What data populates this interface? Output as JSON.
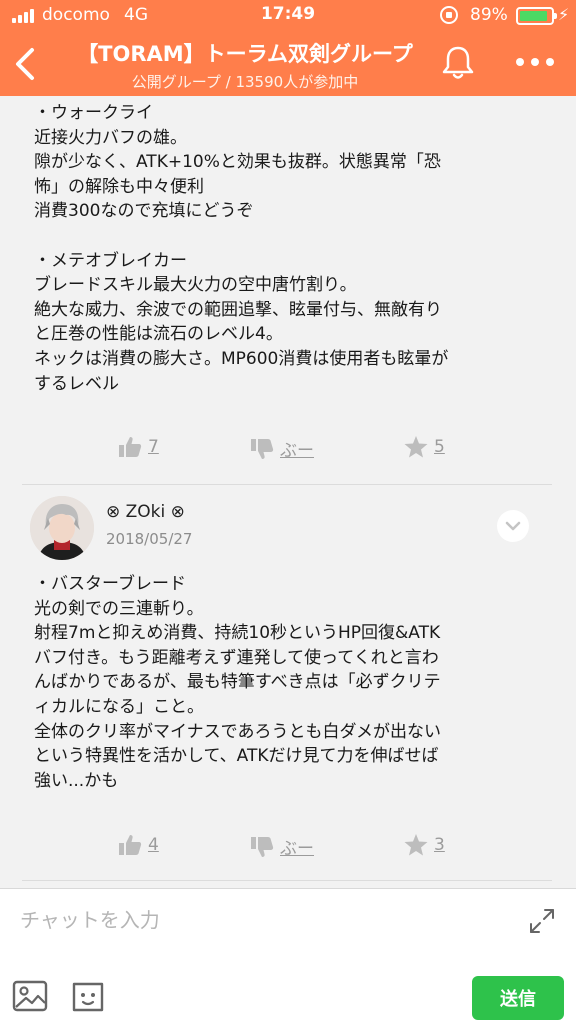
{
  "status_bar": {
    "carrier": "docomo",
    "network": "4G",
    "time": "17:49",
    "battery_percent": "89%",
    "battery_level": 0.89,
    "battery_color": "#4cd964"
  },
  "header": {
    "title": "【TORAM】トーラム双剣グループ",
    "subtitle": "公開グループ / 13590人が参加中",
    "background_color": "#ff7e4b",
    "icons": [
      "back-icon",
      "bell-icon",
      "more-icon"
    ]
  },
  "posts": [
    {
      "lines": [
        "・ウォークライ",
        "近接火力バフの雄。",
        "隙が少なく、ATK+10%と効果も抜群。状態異常「恐",
        "怖」の解除も中々便利",
        "消費300なので充填にどうぞ",
        "",
        "・メテオブレイカー",
        "ブレードスキル最大火力の空中唐竹割り。",
        "絶大な威力、余波での範囲追撃、眩暈付与、無敵有り",
        "と圧巻の性能は流石のレベル4。",
        "ネックは消費の膨大さ。MP600消費は使用者も眩暈が",
        "するレベル"
      ],
      "likes": "7",
      "dislike_label": "ぶー",
      "stars": "5"
    },
    {
      "author": "⊗ ZOki ⊗",
      "date": "2018/05/27",
      "lines": [
        "・バスターブレード",
        "光の剣での三連斬り。",
        "射程7mと抑えめ消費、持続10秒というHP回復&ATK",
        "バフ付き。もう距離考えず連発して使ってくれと言わ",
        "んばかりであるが、最も特筆すべき点は「必ずクリテ",
        "ィカルになる」こと。",
        "全体のクリ率がマイナスであろうとも白ダメが出ない",
        "という特異性を活かして、ATKだけ見て力を伸ばせば",
        "強い...かも"
      ],
      "likes": "4",
      "dislike_label": "ぶー",
      "stars": "3"
    }
  ],
  "footer": {
    "placeholder": "チャットを入力",
    "send_label": "送信",
    "send_color": "#2ec24b",
    "icons": [
      "expand-icon",
      "image-icon",
      "emoji-icon"
    ]
  }
}
